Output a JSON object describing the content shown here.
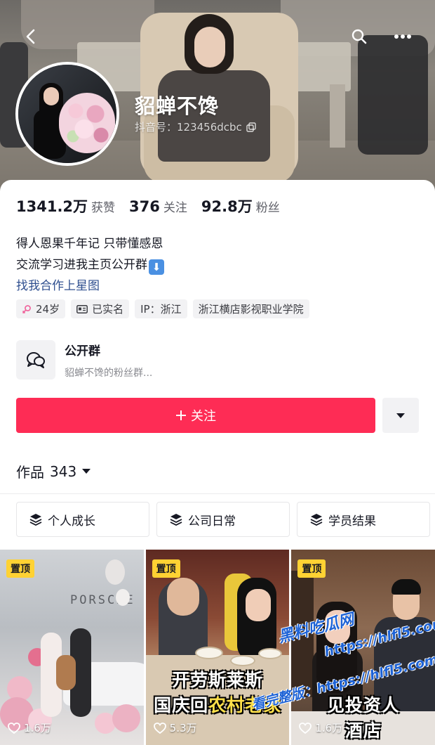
{
  "profile": {
    "nickname": "貂蝉不馋",
    "douyin_id": "抖音号：123456dcbc"
  },
  "stats": [
    {
      "value": "1341.2万",
      "label": "获赞"
    },
    {
      "value": "376",
      "label": "关注"
    },
    {
      "value": "92.8万",
      "label": "粉丝"
    }
  ],
  "bio": {
    "line1": "得人恩果千年记 只带懂感恩",
    "line2": "交流学习进我主页公开群",
    "line2_emoji": "⬇",
    "link": "找我合作上星图"
  },
  "tags": {
    "age": "24岁",
    "verified": "已实名",
    "ip": "IP：浙江",
    "school": "浙江横店影视职业学院"
  },
  "group": {
    "title": "公开群",
    "subtitle": "貂蝉不馋的粉丝群..."
  },
  "follow_button": {
    "label": "关注",
    "icon": "plus-icon"
  },
  "works": {
    "label": "作品",
    "count": "343"
  },
  "collections": [
    {
      "label": "个人成长",
      "icon": "layers-icon"
    },
    {
      "label": "公司日常",
      "icon": "layers-icon"
    },
    {
      "label": "学员结果",
      "icon": "layers-icon"
    }
  ],
  "videos": [
    {
      "pin": "置顶",
      "likes": "1.6万",
      "sign_text": "PORSCHE"
    },
    {
      "pin": "置顶",
      "likes": "5.3万",
      "caption1": "开劳斯莱斯",
      "caption2_a": "国庆回",
      "caption2_b": "农村老家"
    },
    {
      "pin": "置顶",
      "likes": "1.6万",
      "caption1": "见投资人",
      "caption2": "酒店"
    }
  ],
  "watermark": {
    "site_name": "黑料吃瓜网",
    "site_url": "https://hlfl5.com",
    "prefix": "看完整版：https://hlfl5.com"
  },
  "colors": {
    "follow_red": "#fe2c55",
    "pin_yellow": "#ffd233",
    "link_blue": "#2f4f8f"
  }
}
